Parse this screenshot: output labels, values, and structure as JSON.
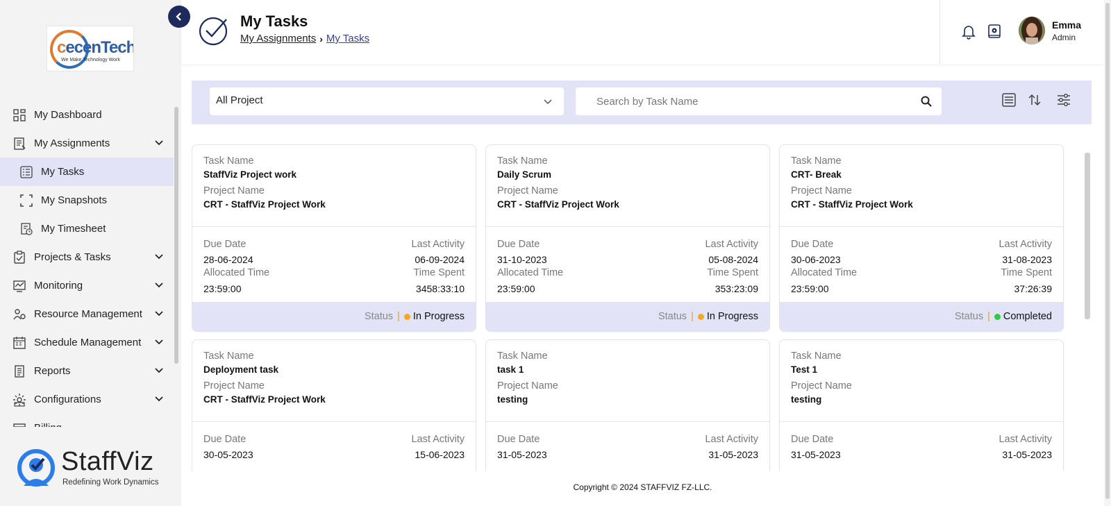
{
  "sidebar": {
    "logo": {
      "brand": "recenTech",
      "brand_initial": "c",
      "tagline": "We Make Technology Work"
    },
    "items": [
      {
        "label": "My Dashboard",
        "icon": "dashboard-icon",
        "sub": false,
        "chevron": false,
        "active": false
      },
      {
        "label": "My Assignments",
        "icon": "assignments-icon",
        "sub": false,
        "chevron": true,
        "active": false
      },
      {
        "label": "My Tasks",
        "icon": "tasks-list-icon",
        "sub": true,
        "chevron": false,
        "active": true
      },
      {
        "label": "My Snapshots",
        "icon": "snapshot-frame-icon",
        "sub": true,
        "chevron": false,
        "active": false
      },
      {
        "label": "My Timesheet",
        "icon": "timesheet-icon",
        "sub": true,
        "chevron": false,
        "active": false
      },
      {
        "label": "Projects & Tasks",
        "icon": "clipboard-icon",
        "sub": false,
        "chevron": true,
        "active": false
      },
      {
        "label": "Monitoring",
        "icon": "monitoring-icon",
        "sub": false,
        "chevron": true,
        "active": false
      },
      {
        "label": "Resource Management",
        "icon": "resource-icon",
        "sub": false,
        "chevron": true,
        "active": false
      },
      {
        "label": "Schedule Management",
        "icon": "schedule-icon",
        "sub": false,
        "chevron": true,
        "active": false
      },
      {
        "label": "Reports",
        "icon": "reports-icon",
        "sub": false,
        "chevron": true,
        "active": false
      },
      {
        "label": "Configurations",
        "icon": "configurations-icon",
        "sub": false,
        "chevron": true,
        "active": false
      },
      {
        "label": "Billing",
        "icon": "billing-icon",
        "sub": false,
        "chevron": false,
        "active": false
      }
    ],
    "footer": {
      "name": "StaffViz",
      "tagline": "Redefining Work Dynamics"
    }
  },
  "header": {
    "title": "My Tasks",
    "breadcrumb": [
      "My Assignments",
      "My Tasks"
    ],
    "user": {
      "name": "Emma",
      "role": "Admin"
    }
  },
  "filters": {
    "project_select": "All Project",
    "search_placeholder": "Search by Task Name"
  },
  "labels": {
    "task_name": "Task Name",
    "project_name": "Project Name",
    "due_date": "Due Date",
    "last_activity": "Last Activity",
    "allocated_time": "Allocated Time",
    "time_spent": "Time Spent",
    "status": "Status",
    "status_sep": "|"
  },
  "colors": {
    "accent": "#1f2a5c",
    "status_in_progress": "#f5a623",
    "status_completed": "#2ecc40",
    "filter_bar_bg": "#e2e3f7"
  },
  "tasks": [
    {
      "task_name": "StaffViz Project work",
      "project_name": "CRT - StaffViz Project Work",
      "due_date": "28-06-2024",
      "last_activity": "06-09-2024",
      "allocated_time": "23:59:00",
      "time_spent": "3458:33:10",
      "status": "In Progress",
      "status_color": "#f5a623"
    },
    {
      "task_name": "Daily Scrum",
      "project_name": "CRT - StaffViz Project Work",
      "due_date": "31-10-2023",
      "last_activity": "05-08-2024",
      "allocated_time": "23:59:00",
      "time_spent": "353:23:09",
      "status": "In Progress",
      "status_color": "#f5a623"
    },
    {
      "task_name": "CRT- Break",
      "project_name": "CRT - StaffViz Project Work",
      "due_date": "30-06-2023",
      "last_activity": "31-08-2023",
      "allocated_time": "23:59:00",
      "time_spent": "37:26:39",
      "status": "Completed",
      "status_color": "#2ecc40"
    },
    {
      "task_name": "Deployment task",
      "project_name": "CRT - StaffViz Project Work",
      "due_date": "30-05-2023",
      "last_activity": "15-06-2023"
    },
    {
      "task_name": "task 1",
      "project_name": "testing",
      "due_date": "31-05-2023",
      "last_activity": "31-05-2023"
    },
    {
      "task_name": "Test 1",
      "project_name": "testing",
      "due_date": "31-05-2023",
      "last_activity": "31-05-2023"
    }
  ],
  "footer": {
    "copyright": "Copyright © 2024 STAFFVIZ FZ-LLC."
  }
}
